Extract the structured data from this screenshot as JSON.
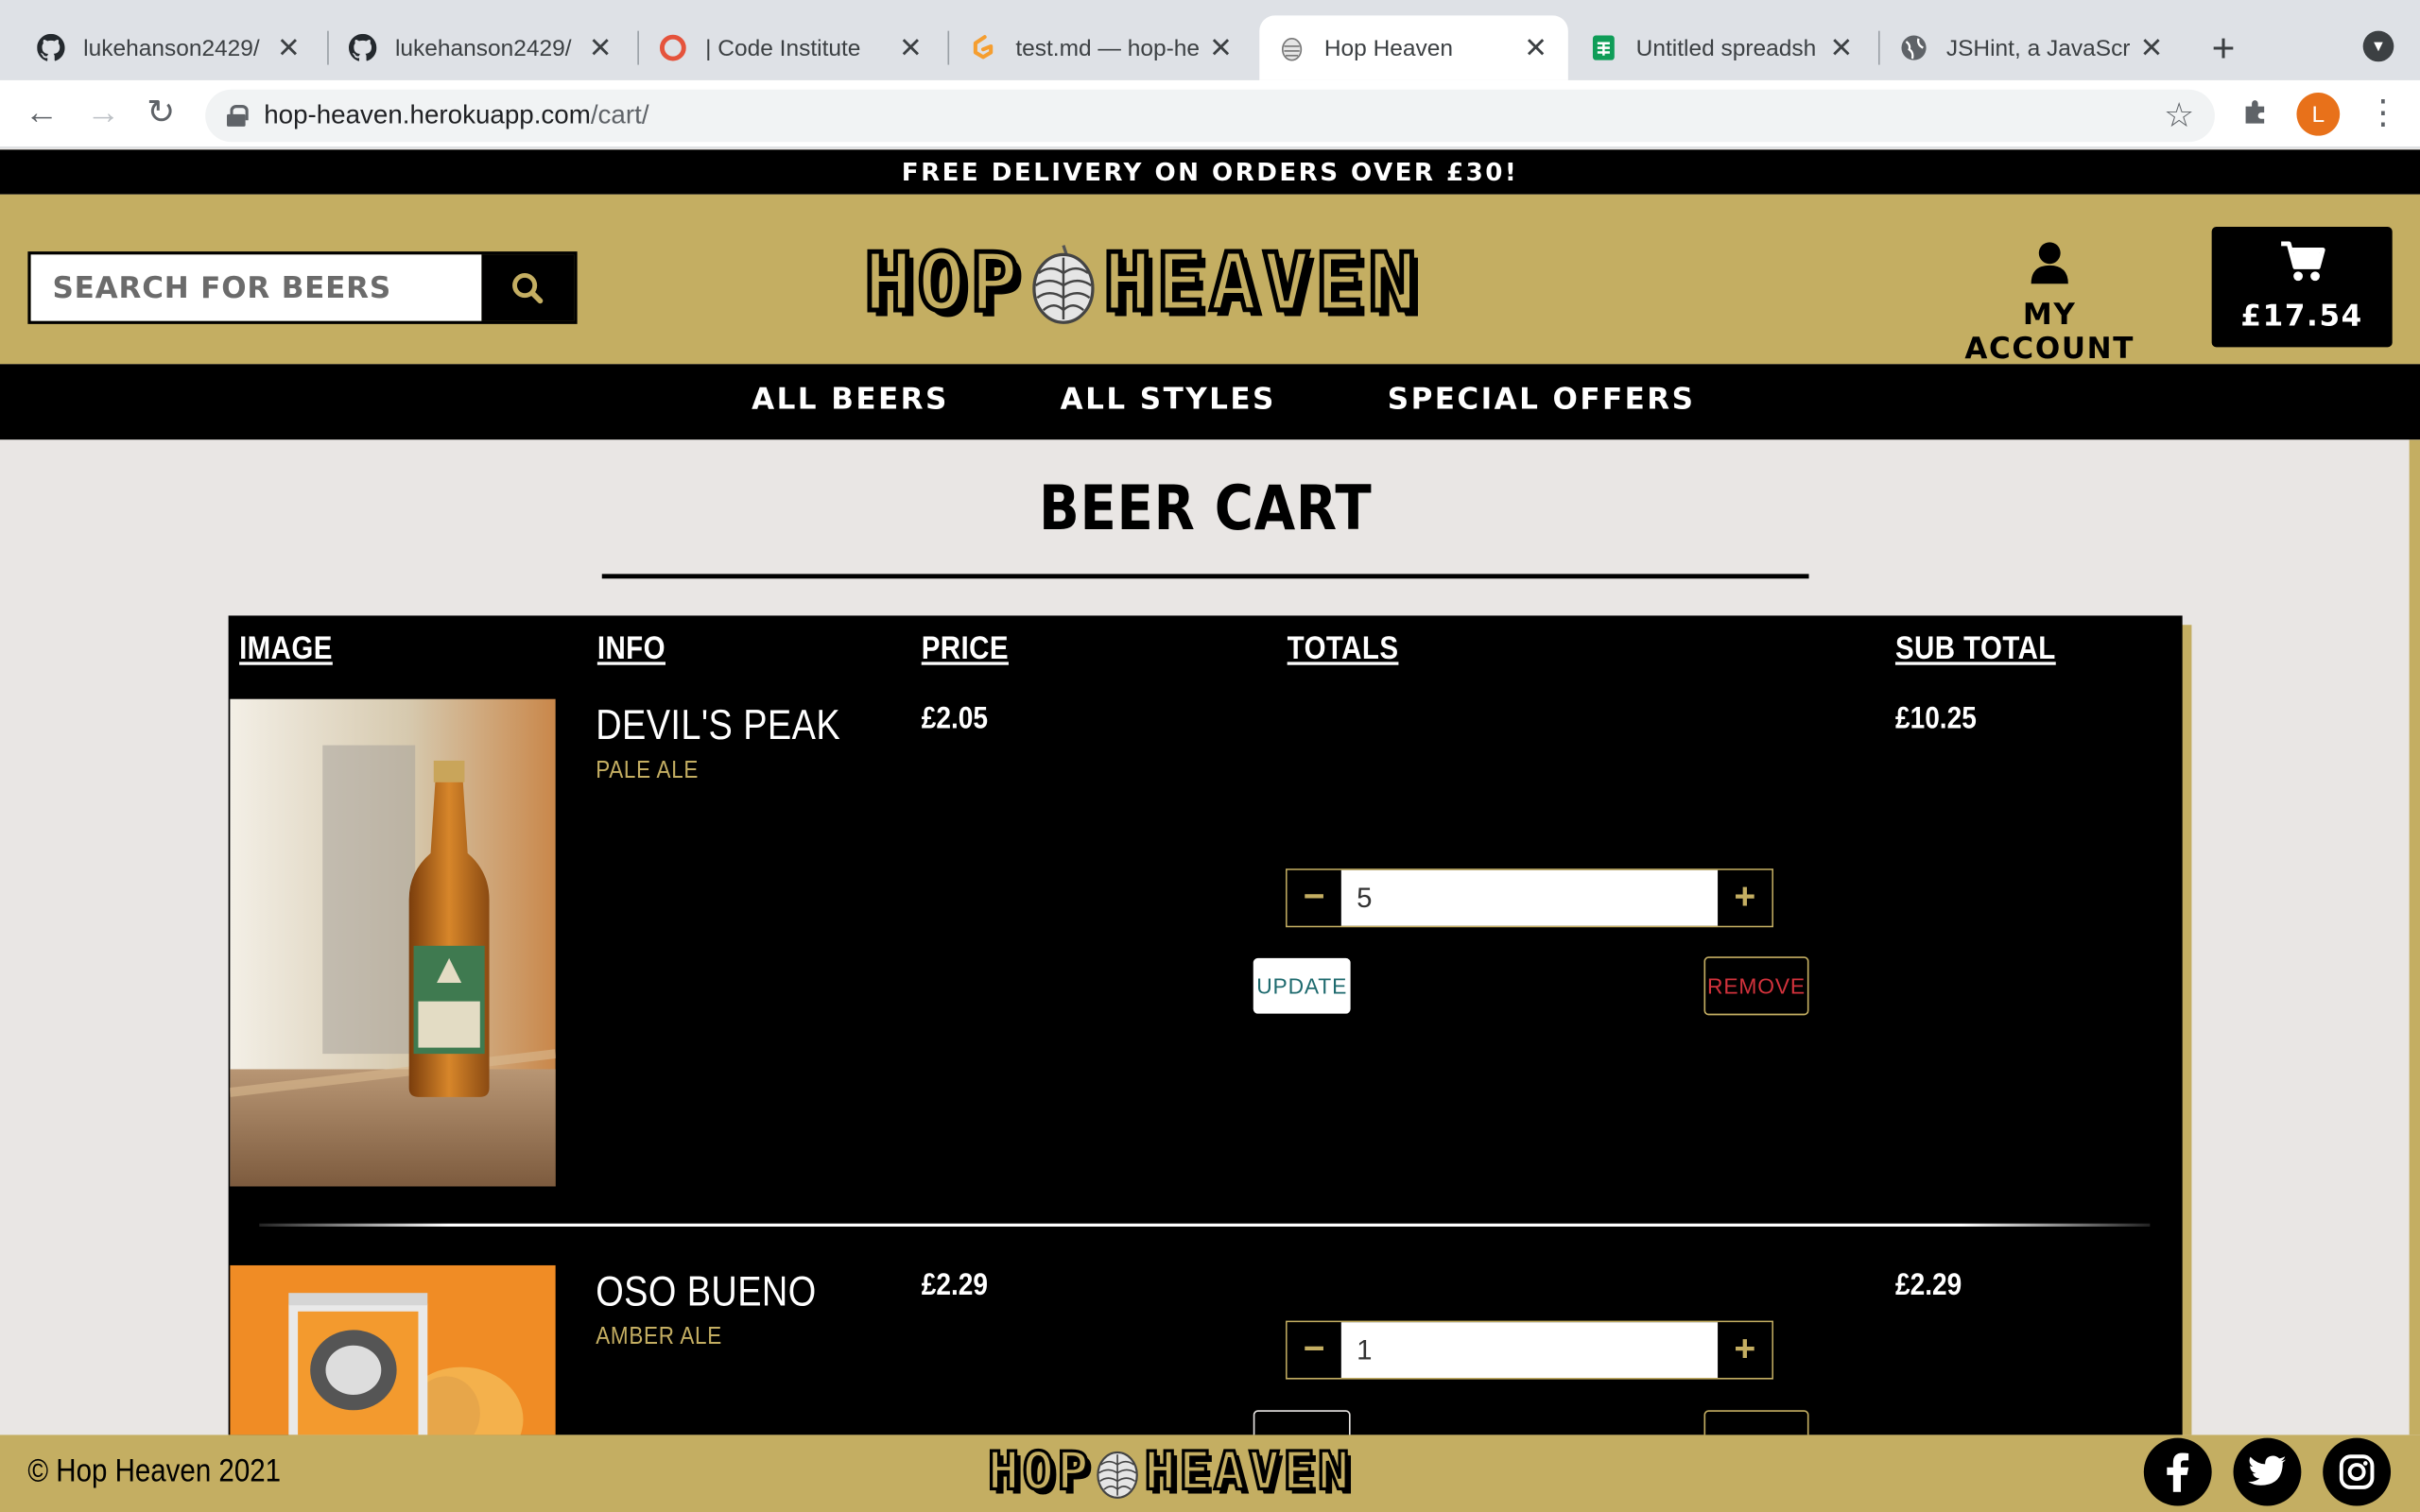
{
  "browser": {
    "tabs": [
      {
        "title": "lukehanson2429/",
        "icon": "github-icon",
        "active": false
      },
      {
        "title": "lukehanson2429/",
        "icon": "github-icon",
        "active": false
      },
      {
        "title": "| Code Institute",
        "icon": "code-institute-icon",
        "active": false
      },
      {
        "title": "test.md — hop-he",
        "icon": "gitpod-icon",
        "active": false
      },
      {
        "title": "Hop Heaven",
        "icon": "hop-icon",
        "active": true
      },
      {
        "title": "Untitled spreadsh",
        "icon": "sheets-icon",
        "active": false
      },
      {
        "title": "JSHint, a JavaScr",
        "icon": "globe-icon",
        "active": false
      }
    ],
    "url_host": "hop-heaven.herokuapp.com",
    "url_path": "/cart/",
    "profile_initial": "L"
  },
  "site": {
    "promo": "FREE DELIVERY ON ORDERS OVER £30!",
    "search_placeholder": "SEARCH FOR BEERS",
    "logo_left": "HOP",
    "logo_right": "HEAVEN",
    "account_label": "MY ACCOUNT",
    "cart_total": "£17.54",
    "nav": [
      "ALL BEERS",
      "ALL STYLES",
      "SPECIAL OFFERS"
    ],
    "brand_color": "#c4ae62"
  },
  "cart": {
    "title": "BEER CART",
    "headers": {
      "image": "IMAGE",
      "info": "INFO",
      "price": "PRICE",
      "totals": "TOTALS",
      "subtotal": "SUB TOTAL"
    },
    "update_label": "UPDATE",
    "remove_label": "REMOVE",
    "items": [
      {
        "name": "DEVIL'S PEAK",
        "style": "PALE ALE",
        "price": "£2.05",
        "qty": "5",
        "subtotal": "£10.25"
      },
      {
        "name": "OSO BUENO",
        "style": "AMBER ALE",
        "price": "£2.29",
        "qty": "1",
        "subtotal": "£2.29"
      }
    ]
  },
  "footer": {
    "copyright": "© Hop Heaven 2021",
    "social": [
      "facebook-icon",
      "twitter-icon",
      "instagram-icon"
    ]
  }
}
